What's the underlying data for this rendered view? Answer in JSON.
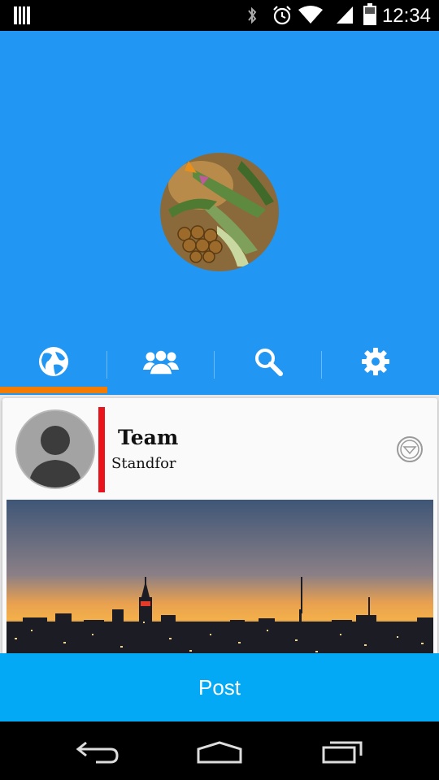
{
  "status_bar": {
    "time": "12:34",
    "icons": [
      "notification-icon",
      "bluetooth-icon",
      "alarm-icon",
      "wifi-icon",
      "signal-icon",
      "battery-icon"
    ]
  },
  "header": {
    "background_color": "#2196f3",
    "profile_image": "plant-photo"
  },
  "tabs": [
    {
      "name": "globe-icon",
      "active": true
    },
    {
      "name": "people-icon",
      "active": false
    },
    {
      "name": "search-icon",
      "active": false
    },
    {
      "name": "gear-icon",
      "active": false
    }
  ],
  "tab_indicator_color": "#f57c00",
  "card": {
    "title": "Team",
    "subtitle": "Standfor",
    "accent_color": "#e8131b",
    "image": "city-skyline-photo"
  },
  "post_button": {
    "label": "Post",
    "color": "#03a9f4"
  },
  "navigation": [
    "back-icon",
    "home-icon",
    "recents-icon"
  ]
}
